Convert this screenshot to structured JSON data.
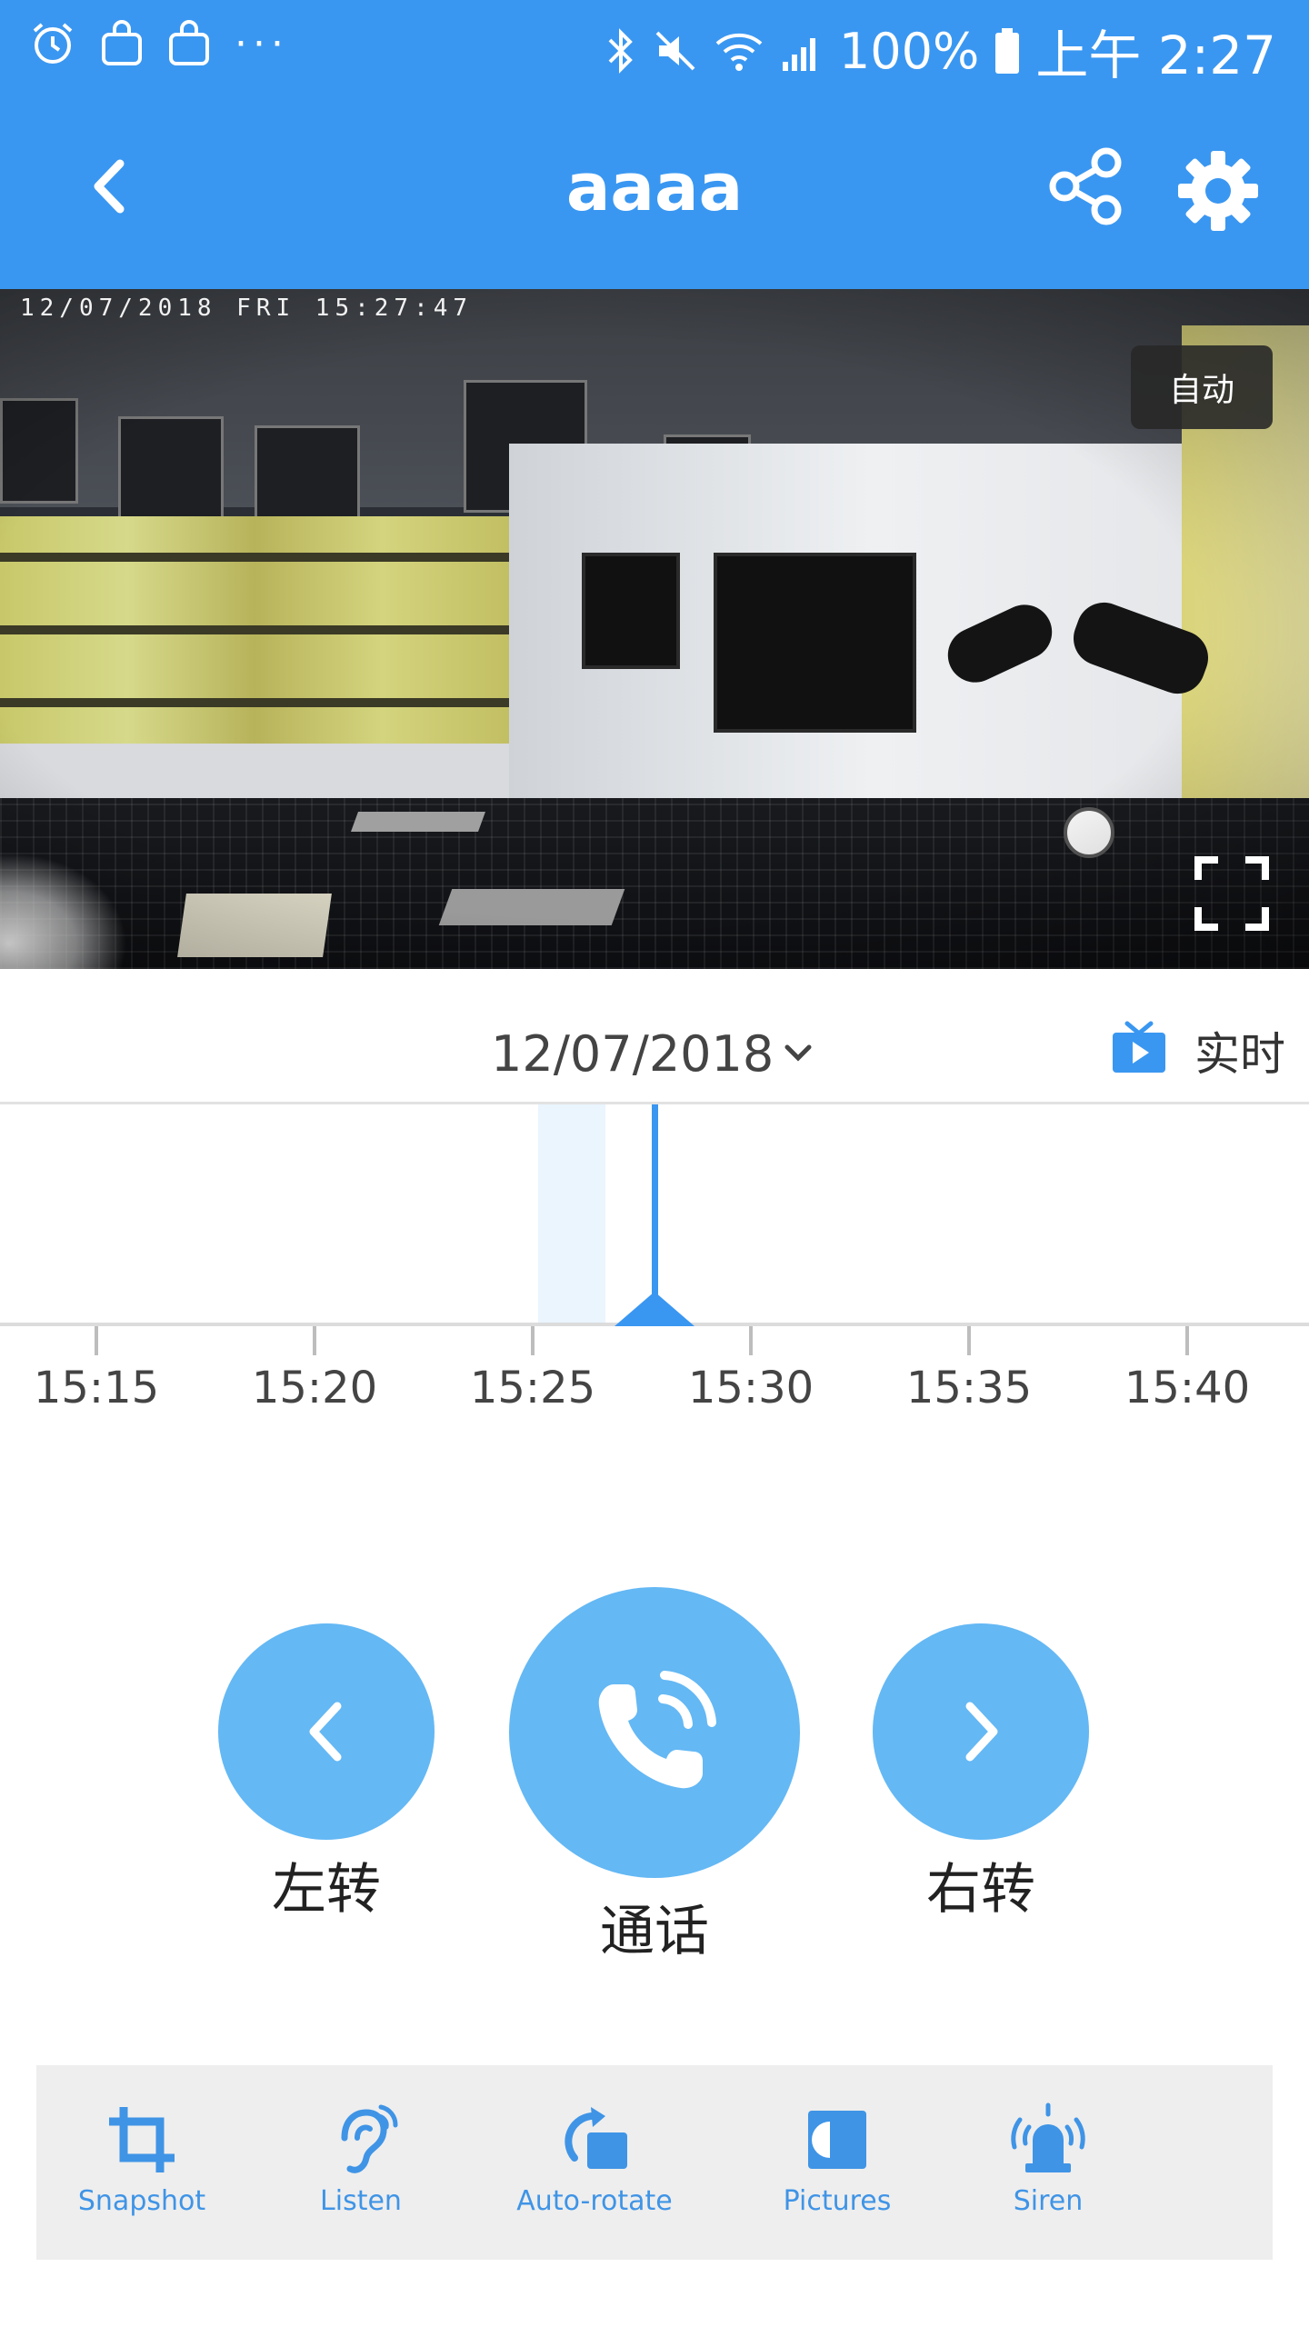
{
  "status_bar": {
    "battery": "100%",
    "time": "上午 2:27",
    "overflow": "···"
  },
  "header": {
    "title": "aaaa"
  },
  "video": {
    "osd_timestamp": "12/07/2018  FRI  15:27:47",
    "mode_badge": "自动"
  },
  "playback": {
    "date": "12/07/2018",
    "live_label": "实时"
  },
  "timeline": {
    "ticks": [
      "15:15",
      "15:20",
      "15:25",
      "15:30",
      "15:35",
      "15:40"
    ],
    "cursor_time": "15:27:47"
  },
  "controls": {
    "left_label": "左转",
    "talk_label": "通话",
    "right_label": "右转"
  },
  "toolbar": {
    "items": [
      {
        "label": "Snapshot",
        "icon": "crop-icon"
      },
      {
        "label": "Listen",
        "icon": "ear-icon"
      },
      {
        "label": "Auto-rotate",
        "icon": "rotate-icon"
      },
      {
        "label": "Pictures",
        "icon": "pictures-icon"
      },
      {
        "label": "Siren",
        "icon": "siren-icon"
      }
    ]
  },
  "colors": {
    "brand_blue": "#3a97f1",
    "control_blue": "#64b8f4",
    "toolbar_text": "#3f94e6"
  }
}
